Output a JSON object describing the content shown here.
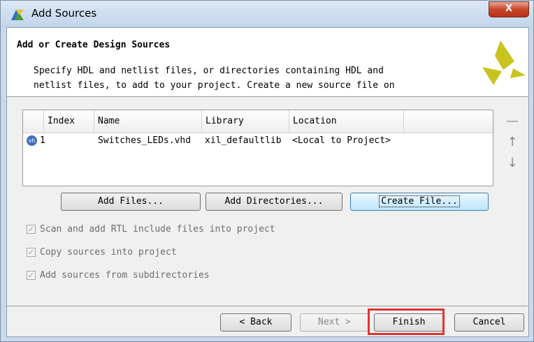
{
  "window": {
    "title": "Add Sources",
    "close_label": "X"
  },
  "header": {
    "title": "Add or Create Design Sources",
    "description": "Specify HDL and netlist files, or directories containing HDL and\nnetlist files, to add to your project. Create a new source file on"
  },
  "table": {
    "columns": [
      "Index",
      "Name",
      "Library",
      "Location"
    ],
    "rows": [
      {
        "icon": "vhdl-file-icon",
        "index": "1",
        "name": "Switches_LEDs.vhd",
        "library": "xil_defaultlib",
        "location": "<Local to Project>"
      }
    ]
  },
  "side_buttons": [
    "remove-icon",
    "move-up-icon",
    "move-down-icon"
  ],
  "buttons": {
    "add_files": "Add Files...",
    "add_directories": "Add Directories...",
    "create_file": "Create File..."
  },
  "options": [
    {
      "label": "Scan and add RTL include files into project",
      "checked": true,
      "enabled": false
    },
    {
      "label": "Copy sources into project",
      "checked": true,
      "enabled": false
    },
    {
      "label": "Add sources from subdirectories",
      "checked": true,
      "enabled": false
    }
  ],
  "footer": {
    "back": "< Back",
    "next": "Next >",
    "finish": "Finish",
    "cancel": "Cancel"
  },
  "colors": {
    "highlight": "#e0342f",
    "logo": "#c9c31f"
  }
}
